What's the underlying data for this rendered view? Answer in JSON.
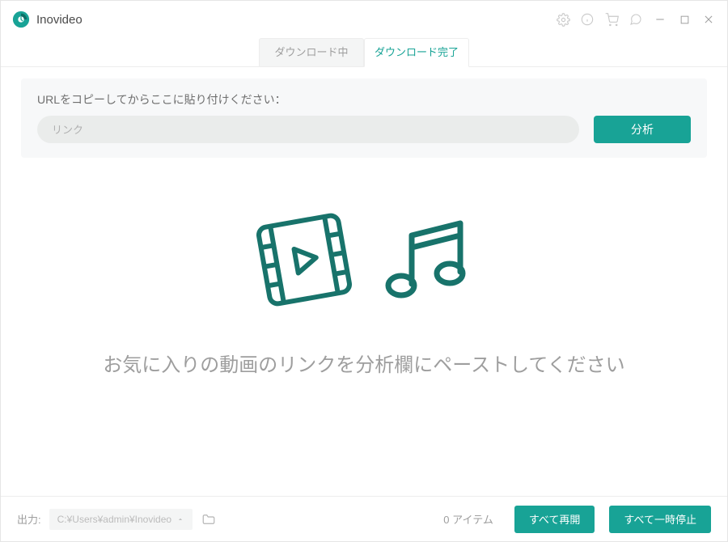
{
  "app": {
    "title": "Inovideo"
  },
  "tabs": {
    "downloading": "ダウンロード中",
    "completed": "ダウンロード完了"
  },
  "url_panel": {
    "label": "URLをコピーしてからここに貼り付けください：",
    "placeholder": "リンク",
    "analyze": "分析"
  },
  "center": {
    "hint": "お気に入りの動画のリンクを分析欄にペーストしてください"
  },
  "footer": {
    "output_label": "出力:",
    "output_path": "C:¥Users¥admin¥Inovideo",
    "item_count": "0 アイテム",
    "resume_all": "すべて再開",
    "pause_all": "すべて一時停止"
  },
  "colors": {
    "accent": "#18a396"
  }
}
